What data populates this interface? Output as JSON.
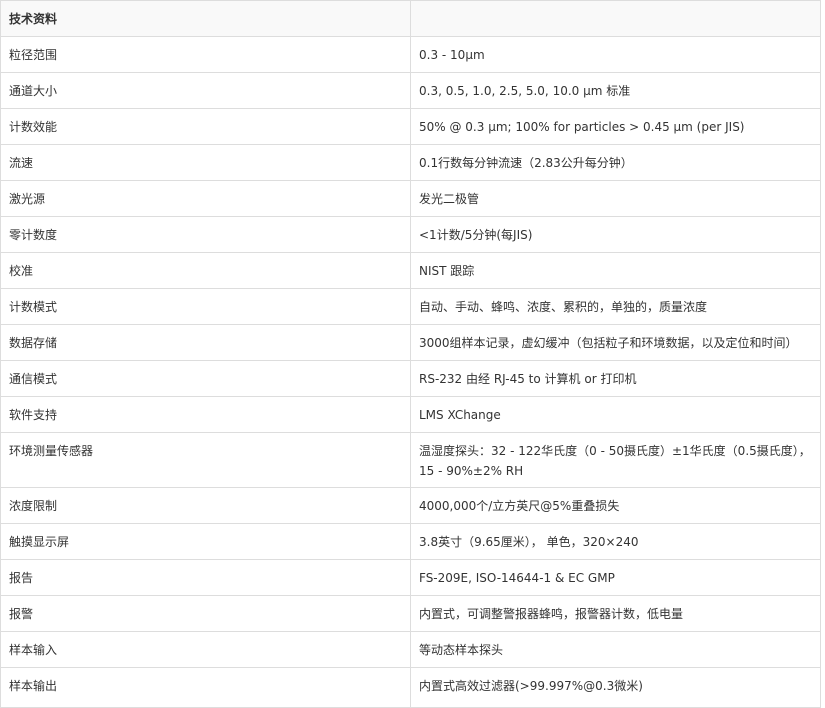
{
  "table": {
    "header": "技术资料",
    "rows": [
      {
        "label": "粒径范围",
        "value": "0.3 - 10µm"
      },
      {
        "label": "通道大小",
        "value": "0.3, 0.5, 1.0, 2.5, 5.0, 10.0 µm 标准"
      },
      {
        "label": "计数效能",
        "value": "50% @ 0.3 µm; 100% for particles > 0.45 µm (per JIS)"
      },
      {
        "label": "流速",
        "value": "0.1行数每分钟流速（2.83公升每分钟）"
      },
      {
        "label": "激光源",
        "value": "发光二极管"
      },
      {
        "label": "零计数度",
        "value": "<1计数/5分钟(每JIS)"
      },
      {
        "label": "校准",
        "value": "NIST 跟踪"
      },
      {
        "label": "计数模式",
        "value": "自动、手动、蜂鸣、浓度、累积的，单独的，质量浓度"
      },
      {
        "label": "数据存储",
        "value": "3000组样本记录，虚幻缓冲（包括粒子和环境数据，以及定位和时间）"
      },
      {
        "label": "通信模式",
        "value": "RS-232 由经 RJ-45 to 计算机 or 打印机"
      },
      {
        "label": "软件支持",
        "value": "LMS XChange"
      },
      {
        "label": "环境测量传感器",
        "value": "温湿度探头：32 - 122华氏度（0 - 50摄氏度）±1华氏度（0.5摄氏度），15 - 90%±2% RH"
      },
      {
        "label": "浓度限制",
        "value": "4000,000个/立方英尺@5%重叠损失"
      },
      {
        "label": "触摸显示屏",
        "value": "3.8英寸（9.65厘米）， 单色，320×240"
      },
      {
        "label": "报告",
        "value": "FS-209E, ISO-14644-1 & EC GMP"
      },
      {
        "label": "报警",
        "value": "内置式，可调整警报器蜂鸣，报警器计数，低电量"
      },
      {
        "label": "样本输入",
        "value": "等动态样本探头"
      },
      {
        "label": "样本输出",
        "value": "内置式高效过滤器(>99.997%@0.3微米)"
      }
    ]
  }
}
